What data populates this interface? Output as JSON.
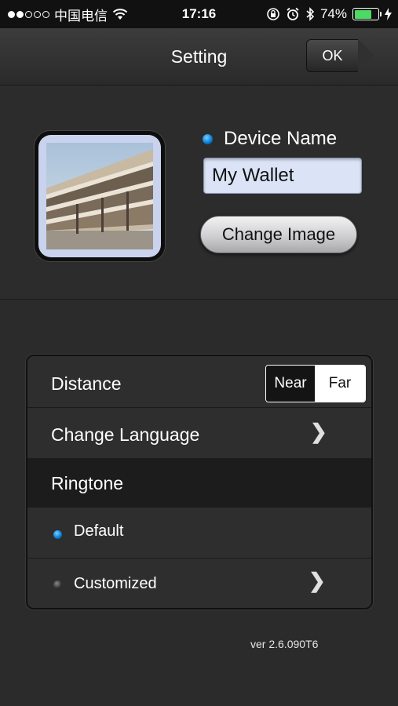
{
  "status_bar": {
    "carrier": "中国电信",
    "time": "17:16",
    "battery_percent": "74%",
    "battery_level": 0.74,
    "icons": [
      "signal-dots-icon",
      "wifi-icon",
      "rotation-lock-icon",
      "alarm-icon",
      "bluetooth-icon",
      "battery-icon",
      "charging-icon"
    ]
  },
  "nav": {
    "title": "Setting",
    "ok_label": "OK"
  },
  "device": {
    "name_label": "Device Name",
    "name_value": "My Wallet",
    "change_image_label": "Change Image"
  },
  "settings": {
    "distance_label": "Distance",
    "distance_options": [
      "Near",
      "Far"
    ],
    "distance_selected": "Far",
    "change_language_label": "Change Language",
    "ringtone_label": "Ringtone",
    "ringtone_default_label": "Default",
    "ringtone_customized_label": "Customized",
    "ringtone_selected": "Default"
  },
  "version": "ver 2.6.090T6",
  "colors": {
    "accent_blue": "#0a7fd9",
    "battery_green": "#4cd964",
    "background": "#2b2b2c"
  }
}
